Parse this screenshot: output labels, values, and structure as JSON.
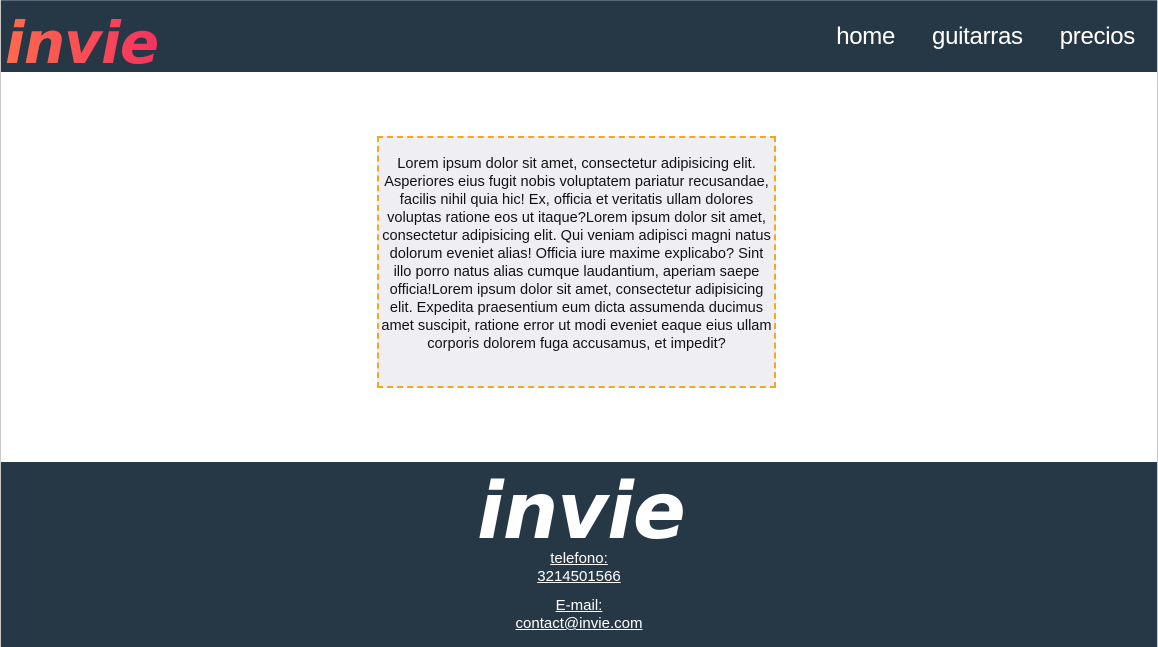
{
  "header": {
    "logo_text": "invie",
    "nav": [
      {
        "label": "home"
      },
      {
        "label": "guitarras"
      },
      {
        "label": "precios"
      }
    ]
  },
  "main": {
    "text": "Lorem ipsum dolor sit amet, consectetur adipisicing elit. Asperiores eius fugit nobis voluptatem pariatur recusandae, facilis nihil quia hic! Ex, officia et veritatis ullam dolores voluptas ratione eos ut itaque?Lorem ipsum dolor sit amet, consectetur adipisicing elit. Qui veniam adipisci magni natus dolorum eveniet alias! Officia iure maxime explicabo? Sint illo porro natus alias cumque laudantium, aperiam saepe officia!Lorem ipsum dolor sit amet, consectetur adipisicing elit. Expedita praesentium eum dicta assumenda ducimus amet suscipit, ratione error ut modi eveniet eaque eius ullam corporis dolorem fuga accusamus, et impedit?"
  },
  "footer": {
    "logo_text": "invie",
    "phone_label": "telefono:",
    "phone_value": "3214501566",
    "email_label": "E-mail:",
    "email_value": "contact@invie.com"
  },
  "colors": {
    "header_bg": "#263746",
    "logo_gradient_start": "#ff6a4d",
    "logo_gradient_end": "#f2335f",
    "box_border": "#f5a623",
    "box_bg": "#efeef3"
  }
}
